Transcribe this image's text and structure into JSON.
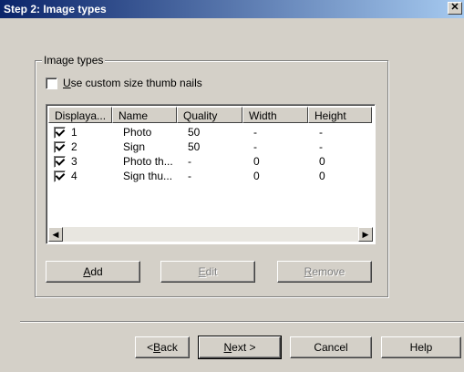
{
  "window": {
    "title": "Step 2: Image types",
    "close_glyph": "✕"
  },
  "group": {
    "legend": "Image types",
    "custom_thumb": {
      "label_prefix": "U",
      "label_rest": "se custom size thumb nails",
      "checked": false
    }
  },
  "list": {
    "columns": [
      "Displaya...",
      "Name",
      "Quality",
      "Width",
      "Height"
    ],
    "rows": [
      {
        "checked": true,
        "id": "1",
        "name": "Photo",
        "quality": "50",
        "width": "-",
        "height": "-"
      },
      {
        "checked": true,
        "id": "2",
        "name": "Sign",
        "quality": "50",
        "width": "-",
        "height": "-"
      },
      {
        "checked": true,
        "id": "3",
        "name": "Photo th...",
        "quality": "-",
        "width": "0",
        "height": "0"
      },
      {
        "checked": true,
        "id": "4",
        "name": "Sign thu...",
        "quality": "-",
        "width": "0",
        "height": "0"
      }
    ],
    "scroll_left_glyph": "◀",
    "scroll_right_glyph": "▶"
  },
  "group_buttons": {
    "add": {
      "u": "A",
      "rest": "dd"
    },
    "edit": {
      "u": "E",
      "rest": "dit"
    },
    "remove": {
      "u": "R",
      "rest": "emove"
    }
  },
  "footer": {
    "back": {
      "pre": "< ",
      "u": "B",
      "rest": "ack"
    },
    "next": {
      "u": "N",
      "rest": "ext >"
    },
    "cancel": "Cancel",
    "help": "Help"
  }
}
